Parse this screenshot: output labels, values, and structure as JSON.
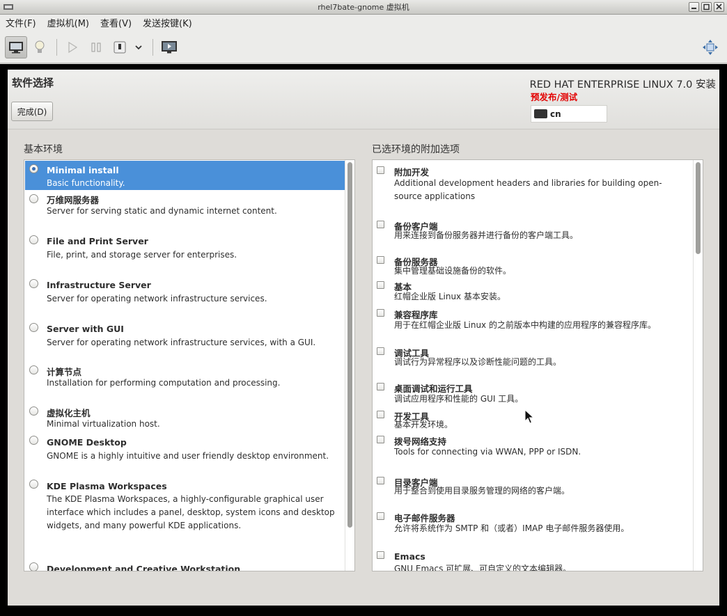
{
  "window": {
    "title": "rhel7bate-gnome 虚拟机"
  },
  "menubar": {
    "items": [
      "文件(F)",
      "虚拟机(M)",
      "查看(V)",
      "发送按键(K)"
    ]
  },
  "toolbar": {
    "buttons": [
      "console-icon",
      "details-lightbulb-icon",
      "run-icon",
      "pause-icon",
      "shutdown-icon",
      "dropdown-chevron-icon",
      "snapshot-screen-icon",
      "fullscreen-icon"
    ]
  },
  "header": {
    "page_title": "软件选择",
    "done_label": "完成(D)",
    "product": "RED HAT ENTERPRISE LINUX 7.0 安装",
    "prerelease": "预发布/测试",
    "keyboard_layout": "cn"
  },
  "base_env": {
    "label": "基本环境",
    "items": [
      {
        "name": "Minimal install",
        "desc": "Basic functionality.",
        "selected": true
      },
      {
        "name": "万维网服务器",
        "desc": "Server for serving static and dynamic internet content.",
        "selected": false
      },
      {
        "name": "File and Print Server",
        "desc": "File, print, and storage server for enterprises.",
        "selected": false
      },
      {
        "name": "Infrastructure Server",
        "desc": "Server for operating network infrastructure services.",
        "selected": false
      },
      {
        "name": "Server with GUI",
        "desc": "Server for operating network infrastructure services, with a GUI.",
        "selected": false
      },
      {
        "name": "计算节点",
        "desc": "Installation for performing computation and processing.",
        "selected": false
      },
      {
        "name": "虚拟化主机",
        "desc": "Minimal virtualization host.",
        "selected": false
      },
      {
        "name": "GNOME Desktop",
        "desc": "GNOME is a highly intuitive and user friendly desktop environment.",
        "selected": false
      },
      {
        "name": "KDE Plasma Workspaces",
        "desc": "The KDE Plasma Workspaces, a highly-configurable graphical user interface which includes a panel, desktop, system icons and desktop widgets, and many powerful KDE applications.",
        "selected": false
      },
      {
        "name": "Development and Creative Workstation",
        "desc": "",
        "selected": false
      }
    ]
  },
  "addons": {
    "label": "已选环境的附加选项",
    "items": [
      {
        "name": "附加开发",
        "desc": "Additional development headers and libraries for building open-source applications",
        "checked": false
      },
      {
        "name": "备份客户端",
        "desc": "用来连接到备份服务器并进行备份的客户端工具。",
        "checked": false
      },
      {
        "name": "备份服务器",
        "desc": "集中管理基础设施备份的软件。",
        "checked": false
      },
      {
        "name": "基本",
        "desc": "红帽企业版 Linux 基本安装。",
        "checked": false
      },
      {
        "name": "兼容程序库",
        "desc": "用于在红帽企业版 Linux 的之前版本中构建的应用程序的兼容程序库。",
        "checked": false
      },
      {
        "name": "调试工具",
        "desc": "调试行为异常程序以及诊断性能问题的工具。",
        "checked": false
      },
      {
        "name": "桌面调试和运行工具",
        "desc": "调试应用程序和性能的 GUI 工具。",
        "checked": false
      },
      {
        "name": "开发工具",
        "desc": "基本开发环境。",
        "checked": false
      },
      {
        "name": "拨号网络支持",
        "desc": "Tools for connecting via WWAN, PPP or ISDN.",
        "checked": false
      },
      {
        "name": "目录客户端",
        "desc": "用于整合到使用目录服务管理的网络的客户端。",
        "checked": false
      },
      {
        "name": "电子邮件服务器",
        "desc": "允许将系统作为 SMTP 和（或者）IMAP 电子邮件服务器使用。",
        "checked": false
      },
      {
        "name": "Emacs",
        "desc": "GNU Emacs 可扩展、可自定义的文本编辑器。",
        "checked": false
      }
    ]
  }
}
